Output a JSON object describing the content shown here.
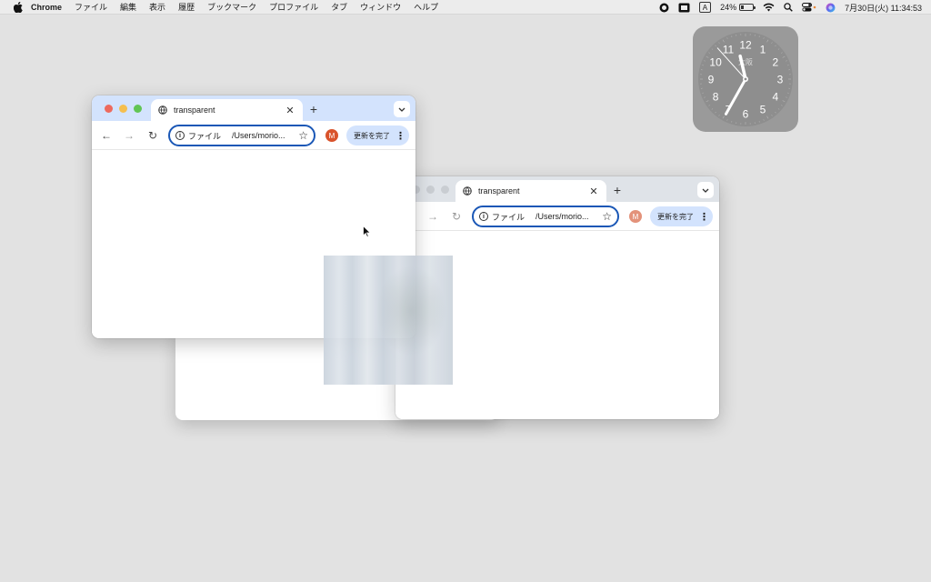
{
  "menubar": {
    "app_name": "Chrome",
    "items": [
      "ファイル",
      "編集",
      "表示",
      "履歴",
      "ブックマーク",
      "プロファイル",
      "タブ",
      "ウィンドウ",
      "ヘルプ"
    ],
    "input_source": "A",
    "battery": "24%",
    "battery_level": 0.24,
    "datetime": "7月30日(火)  11:34:53"
  },
  "clock": {
    "numbers": [
      "12",
      "1",
      "2",
      "3",
      "4",
      "5",
      "6",
      "7",
      "8",
      "9",
      "10",
      "11"
    ],
    "city": "大阪",
    "hour": 11,
    "minute": 34,
    "second": 53
  },
  "window_front": {
    "tab_title": "transparent",
    "new_tab": "+",
    "omnibox_chip": "ファイル",
    "url": "/Users/morio...",
    "avatar_initial": "M",
    "update_label": "更新を完了",
    "avatar_color": "#d9532b"
  },
  "window_back": {
    "tab_title": "transparent",
    "new_tab": "+",
    "omnibox_chip": "ファイル",
    "url": "/Users/morio...",
    "avatar_initial": "M",
    "update_label": "更新を完了",
    "avatar_color": "#e3927a"
  },
  "colors": {
    "desktop": "#e2e2e2",
    "front_tabstrip": "#d3e3fd",
    "back_tabstrip": "#dfe3e8",
    "omnibox_border": "#1a57b6",
    "traffic_red": "#ed6a5e",
    "traffic_yellow": "#f5bf4f",
    "traffic_green": "#61c554"
  }
}
